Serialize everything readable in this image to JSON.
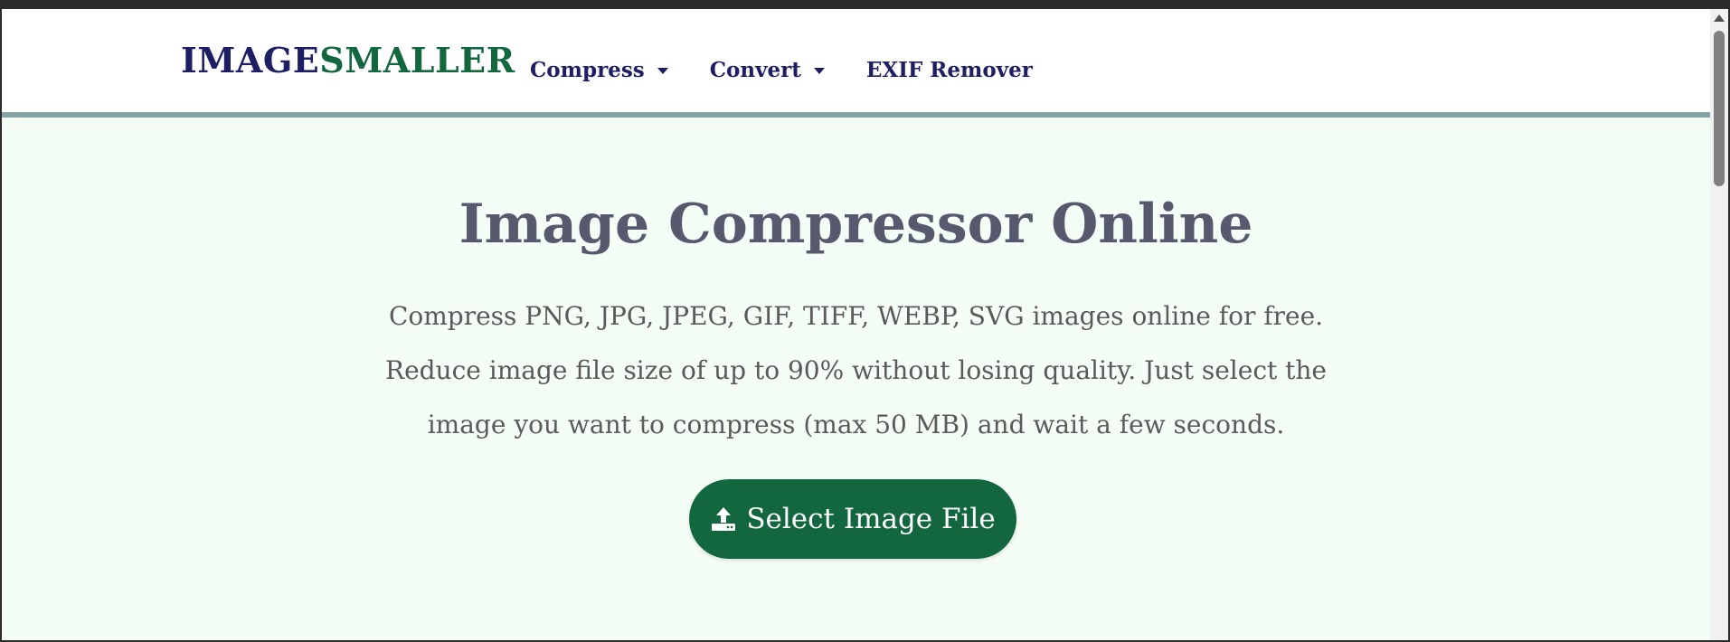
{
  "logo": {
    "part_a": "IMAGE",
    "part_b": "SMALLER"
  },
  "nav": {
    "items": [
      {
        "label": "Compress",
        "has_dropdown": true
      },
      {
        "label": "Convert",
        "has_dropdown": true
      },
      {
        "label": "EXIF Remover",
        "has_dropdown": false
      }
    ]
  },
  "main": {
    "title": "Image Compressor Online",
    "description_lines": [
      "Compress PNG, JPG, JPEG, GIF, TIFF, WEBP, SVG images online for free.",
      "Reduce image file size of up to 90% without losing quality. Just select the",
      "image you want to compress (max 50 MB) and wait a few seconds."
    ],
    "select_button_label": "Select Image File",
    "select_button_icon": "upload-icon"
  },
  "colors": {
    "brand_navy": "#1e1e64",
    "brand_green": "#12673f",
    "background": "#f5fdf7",
    "header_border": "#86a3a5",
    "title": "#575a6e"
  }
}
